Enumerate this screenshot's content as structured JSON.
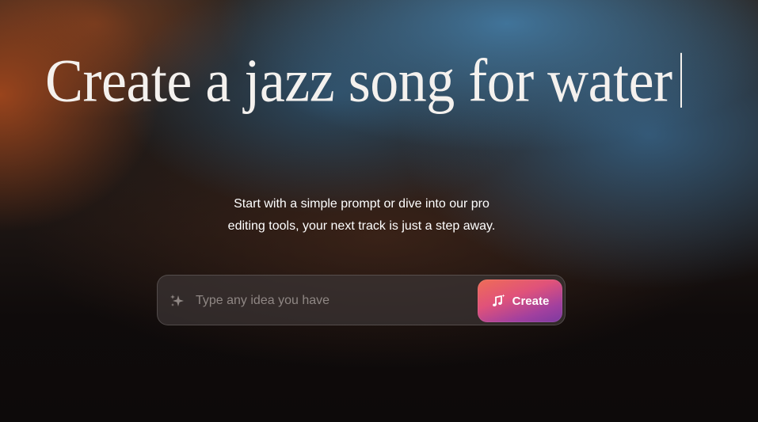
{
  "hero": {
    "headline": "Create a jazz song for water",
    "subtitle_line1": "Start with a simple prompt or dive into our pro",
    "subtitle_line2": "editing tools, your next track is just a step away."
  },
  "prompt": {
    "placeholder": "Type any idea you have",
    "value": "",
    "sparkle_icon": "sparkle-icon"
  },
  "create_button": {
    "label": "Create",
    "icon": "music-note-sparkle-icon"
  },
  "colors": {
    "button_gradient_start": "#ef6d56",
    "button_gradient_end": "#7c3aa0",
    "headline_text": "#f4f1ee"
  }
}
